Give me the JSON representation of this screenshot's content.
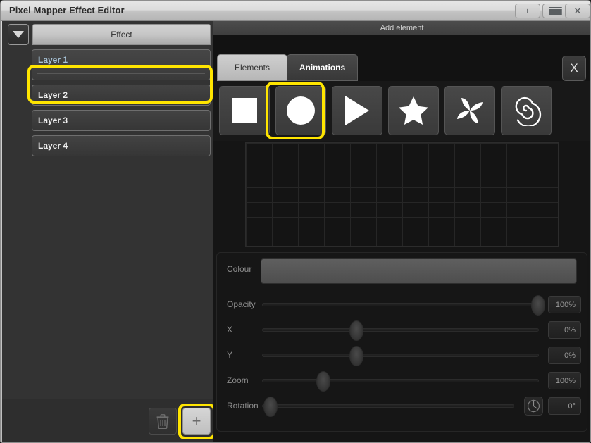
{
  "window": {
    "title": "Pixel Mapper Effect Editor",
    "titlebar_buttons": [
      {
        "name": "info",
        "label": "i"
      },
      {
        "name": "menu",
        "label": ""
      },
      {
        "name": "close",
        "label": "✕"
      }
    ]
  },
  "left_panel": {
    "dropdown_icon": "triangle-down-icon",
    "effect_tab_label": "Effect",
    "layers": [
      {
        "label": "Layer 1",
        "selected": true
      },
      {
        "label": "Layer 2",
        "selected": false
      },
      {
        "label": "Layer 3",
        "selected": false
      },
      {
        "label": "Layer 4",
        "selected": false
      }
    ],
    "toolbar": {
      "delete_icon": "trash-icon",
      "add_label": "+"
    }
  },
  "right_panel": {
    "header": "Add element",
    "tabs": [
      {
        "label": "Elements",
        "active": false
      },
      {
        "label": "Animations",
        "active": true
      }
    ],
    "close_label": "X",
    "elements": [
      {
        "name": "square",
        "icon": "square-icon",
        "highlighted": false
      },
      {
        "name": "circle",
        "icon": "circle-icon",
        "highlighted": true
      },
      {
        "name": "triangle",
        "icon": "triangle-right-icon",
        "highlighted": false
      },
      {
        "name": "star",
        "icon": "star-icon",
        "highlighted": false
      },
      {
        "name": "pinwheel",
        "icon": "pinwheel-icon",
        "highlighted": false
      },
      {
        "name": "spiral",
        "icon": "spiral-icon",
        "highlighted": false
      }
    ],
    "properties": {
      "colour": {
        "label": "Colour",
        "swatch": "#565656"
      },
      "opacity": {
        "label": "Opacity",
        "value": "100%",
        "position": 100
      },
      "x": {
        "label": "X",
        "value": "0%",
        "position": 34
      },
      "y": {
        "label": "Y",
        "value": "0%",
        "position": 34
      },
      "zoom": {
        "label": "Zoom",
        "value": "100%",
        "position": 22
      },
      "rotation": {
        "label": "Rotation",
        "value": "0°",
        "position": 3,
        "dial_icon": "dial-clock-icon"
      }
    }
  },
  "highlight_color": "#ffe500"
}
